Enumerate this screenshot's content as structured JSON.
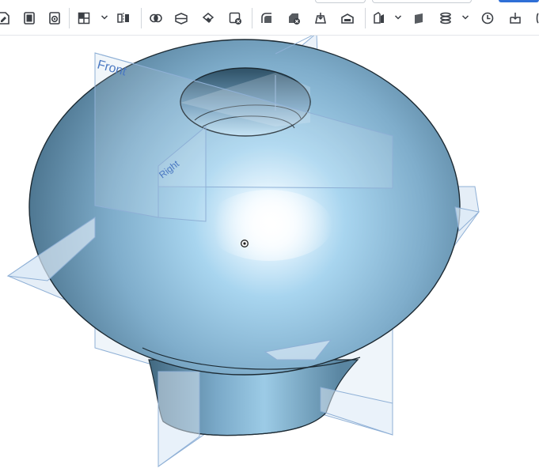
{
  "toolbar": {
    "icons": [
      "sketch-icon",
      "extrude-icon",
      "revolve-icon",
      "pattern-icon",
      "mirror-icon",
      "boolean-icon",
      "split-icon",
      "transform-icon",
      "delete-part-icon",
      "fillet-icon",
      "chamfer-icon",
      "draft-icon",
      "shell-icon",
      "rib-icon",
      "plane-icon",
      "helix-icon",
      "history-icon",
      "import-icon"
    ],
    "colors": {
      "icon": "#3b3f45",
      "separator": "#d2d6db",
      "accent": "#2f6fd6"
    }
  },
  "viewport": {
    "planes": {
      "front_label": "Front",
      "right_label": "Right"
    },
    "colors": {
      "background": "#ffffff",
      "part_light": "#e8f6ff",
      "part_mid": "#9fcde8",
      "part_dark": "#4f7993",
      "edge": "#1c2a33",
      "plane_fill": "#cfe0f0",
      "plane_stroke": "#8fb0d6",
      "plane_label": "#4a78c2"
    }
  }
}
